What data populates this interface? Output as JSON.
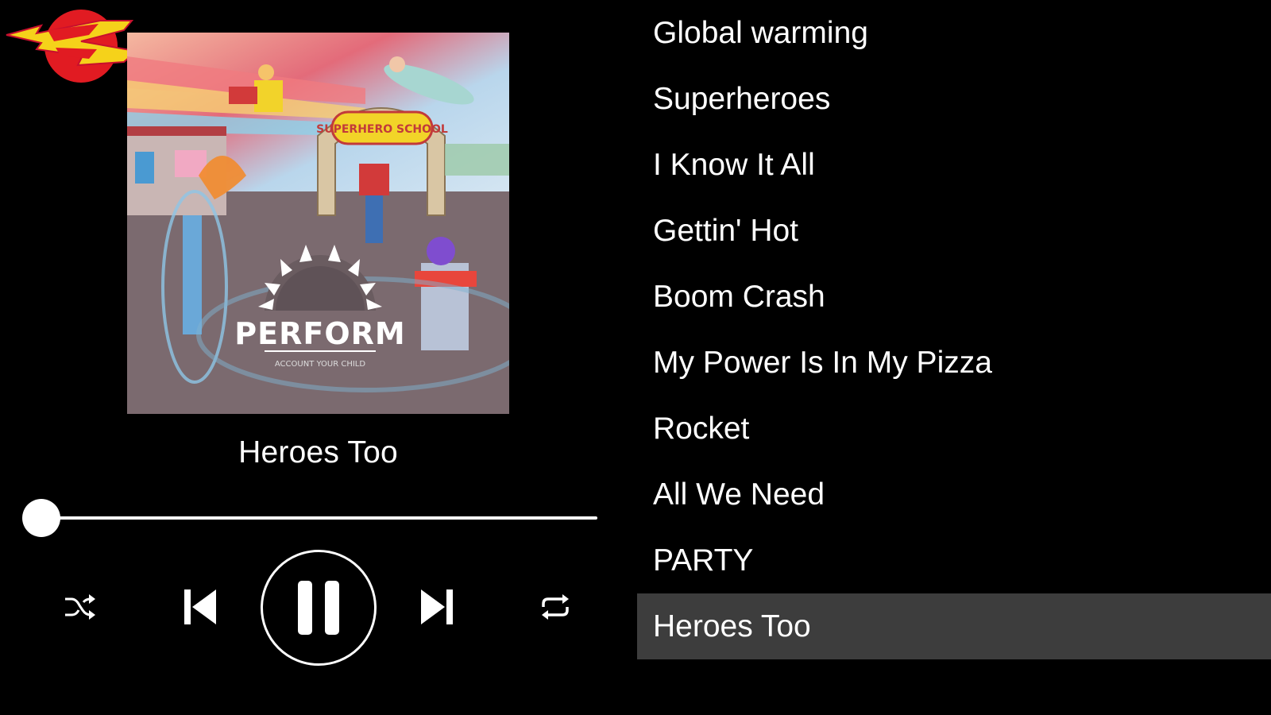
{
  "player": {
    "now_playing_title": "Heroes Too",
    "progress_fraction": 0.0,
    "controls": {
      "shuffle_icon": "shuffle-icon",
      "previous_icon": "skip-previous-icon",
      "play_state_icon": "pause-icon",
      "next_icon": "skip-next-icon",
      "repeat_icon": "repeat-icon"
    }
  },
  "album_art": {
    "sign_text": "SUPERHERO SCHOOL",
    "brand_text": "PERFORM",
    "tagline_text": "ACCOUNT YOUR CHILD"
  },
  "tracklist": {
    "tracks": [
      {
        "title": "Global warming",
        "active": false
      },
      {
        "title": "Superheroes",
        "active": false
      },
      {
        "title": "I Know It All",
        "active": false
      },
      {
        "title": "Gettin' Hot",
        "active": false
      },
      {
        "title": "Boom Crash",
        "active": false
      },
      {
        "title": "My Power Is In My Pizza",
        "active": false
      },
      {
        "title": "Rocket",
        "active": false
      },
      {
        "title": "All We Need",
        "active": false
      },
      {
        "title": "PARTY",
        "active": false
      },
      {
        "title": "Heroes Too",
        "active": true
      }
    ]
  },
  "colors": {
    "background": "#000000",
    "foreground": "#ffffff",
    "active_row": "#3d3d3d",
    "logo_red": "#e11b22",
    "logo_yellow": "#f5d21a"
  }
}
